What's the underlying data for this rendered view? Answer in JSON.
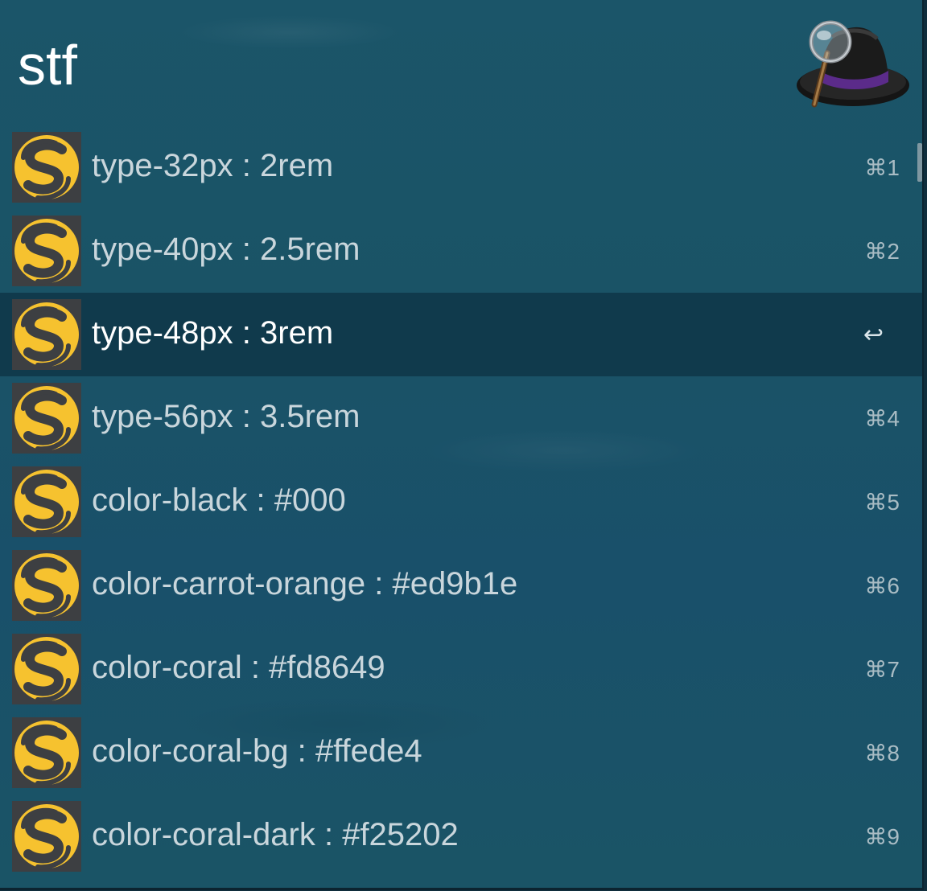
{
  "search": {
    "query": "stf"
  },
  "app": {
    "logo_icon": "alfred-hat-magnifier-icon"
  },
  "result_icon": "sass-s-logo-icon",
  "results": [
    {
      "title": "type-32px : 2rem",
      "shortcut": "⌘1"
    },
    {
      "title": "type-40px : 2.5rem",
      "shortcut": "⌘2"
    },
    {
      "title": "type-48px : 3rem",
      "shortcut": "↩",
      "selected": true
    },
    {
      "title": "type-56px : 3.5rem",
      "shortcut": "⌘4"
    },
    {
      "title": "color-black : #000",
      "shortcut": "⌘5"
    },
    {
      "title": "color-carrot-orange : #ed9b1e",
      "shortcut": "⌘6"
    },
    {
      "title": "color-coral : #fd8649",
      "shortcut": "⌘7"
    },
    {
      "title": "color-coral-bg : #ffede4",
      "shortcut": "⌘8"
    },
    {
      "title": "color-coral-dark : #f25202",
      "shortcut": "⌘9"
    }
  ],
  "colors": {
    "window_bg": "#1b5569",
    "selected_bg": "#143d4f",
    "icon_yellow": "#f6c22f",
    "icon_dark": "#3d3f42"
  }
}
